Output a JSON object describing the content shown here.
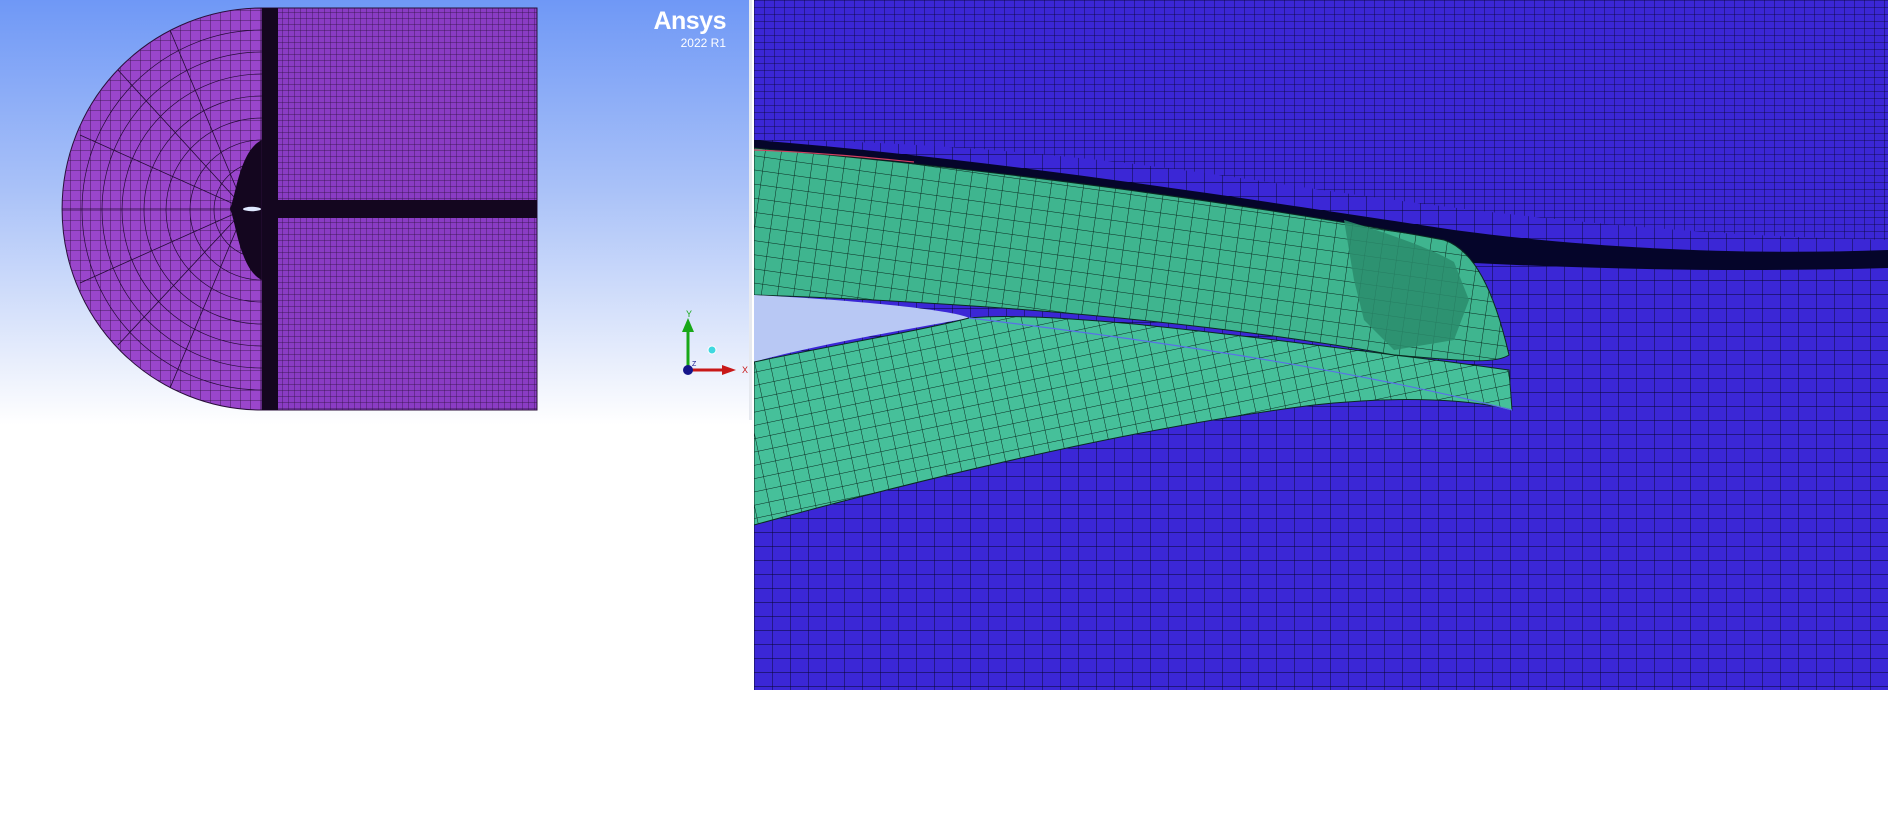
{
  "app": {
    "brand": "Ansys",
    "version": "2022 R1"
  },
  "triad": {
    "y_label": "Y",
    "x_label": "X",
    "z_label": "Z"
  },
  "colors": {
    "left_bg_top": "#6f98f6",
    "left_bg_bottom": "#ffffff",
    "domain_mesh": "#8a3cc4",
    "right_bg": "#3b27d6",
    "cut_surface": "#3fb58f",
    "mesh_lines": "#000000"
  },
  "views": {
    "left": "mesh-overview",
    "right": "mesh-detail"
  }
}
